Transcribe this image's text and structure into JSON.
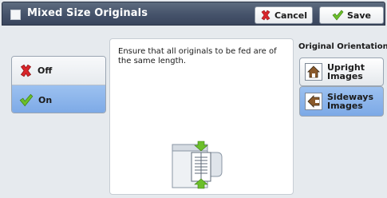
{
  "window": {
    "title": "Mixed Size Originals"
  },
  "toolbar": {
    "cancel_label": "Cancel",
    "save_label": "Save"
  },
  "options": {
    "off_label": "Off",
    "on_label": "On",
    "selected": "On"
  },
  "info": {
    "text": "Ensure that all originals to be fed are of the same length."
  },
  "orientation": {
    "heading": "Original Orientation",
    "upright_label": "Upright Images",
    "sideways_label": "Sideways Images",
    "selected": "Sideways Images"
  },
  "icons": {
    "cancel": "x-icon",
    "save": "checkmark-icon",
    "off": "x-icon",
    "on": "checkmark-icon",
    "upright": "upright-image-icon",
    "sideways": "sideways-image-icon",
    "illustration": "document-feeder-icon"
  },
  "colors": {
    "titlebar": "#45526a",
    "selected": "#8db5eb",
    "cancel_x": "#d9262b",
    "check_green": "#6bbf2a"
  }
}
